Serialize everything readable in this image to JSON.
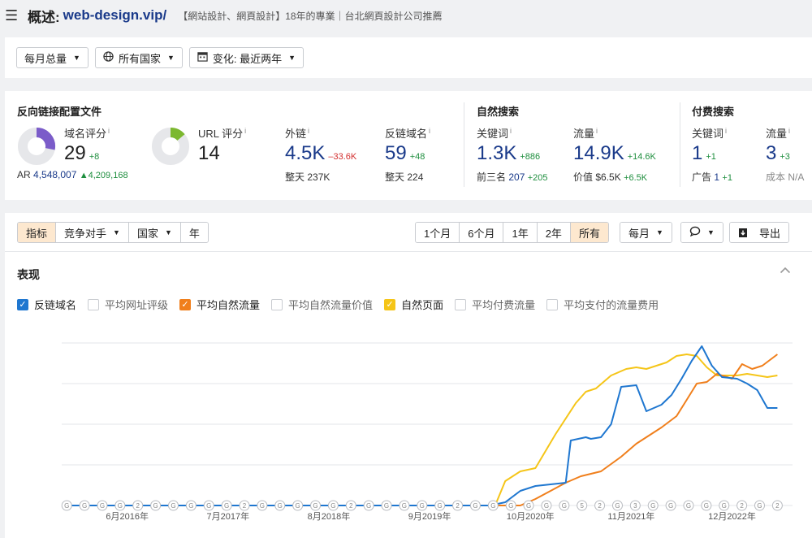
{
  "header": {
    "menu_icon": "hamburger-icon",
    "title_prefix": "概述:",
    "title_domain": "web-design.vip/",
    "description": "【網站設計、網頁設計】18年的專業｜台北網頁設計公司推薦"
  },
  "filters": {
    "volume": "每月总量",
    "country": "所有国家",
    "change": "变化: 最近两年",
    "country_icon": "globe-icon",
    "change_icon": "calendar-icon"
  },
  "backlinks": {
    "title": "反向链接配置文件",
    "dr_label": "域名评分",
    "dr_value": "29",
    "dr_delta": "+8",
    "ar_label": "AR",
    "ar_value": "4,548,007",
    "ar_delta": "▲4,209,168",
    "ur_label": "URL 评分",
    "ur_value": "14",
    "ext_label": "外链",
    "ext_value": "4.5K",
    "ext_delta": "–33.6K",
    "ext_sub_label": "整天",
    "ext_sub_value": "237K",
    "rd_label": "反链域名",
    "rd_value": "59",
    "rd_delta": "+48",
    "rd_sub_label": "整天",
    "rd_sub_value": "224",
    "info": "i"
  },
  "organic": {
    "title": "自然搜索",
    "kw_label": "关键词",
    "kw_value": "1.3K",
    "kw_delta": "+886",
    "top3_label": "前三名",
    "top3_value": "207",
    "top3_delta": "+205",
    "traffic_label": "流量",
    "traffic_value": "14.9K",
    "traffic_delta": "+14.6K",
    "value_label": "价值",
    "value_value": "$6.5K",
    "value_delta": "+6.5K"
  },
  "paid": {
    "title": "付费搜索",
    "kw_label": "关键词",
    "kw_value": "1",
    "kw_delta": "+1",
    "ads_label": "广告",
    "ads_value": "1",
    "ads_delta": "+1",
    "traffic_label": "流量",
    "traffic_value": "3",
    "traffic_delta": "+3",
    "cost_label": "成本",
    "cost_value": "N/A"
  },
  "toolbar": {
    "tabs": [
      "指标",
      "竞争对手",
      "国家",
      "年"
    ],
    "ranges": [
      "1个月",
      "6个月",
      "1年",
      "2年",
      "所有"
    ],
    "interval": "每月",
    "comment_icon": "comment-icon",
    "export": "导出",
    "export_icon": "download-icon"
  },
  "performance": {
    "title": "表现",
    "collapse_icon": "chevron-up-icon",
    "legend": [
      {
        "label": "反链域名",
        "checked": true,
        "color": "#1f77d0"
      },
      {
        "label": "平均网址评级",
        "checked": false
      },
      {
        "label": "平均自然流量",
        "checked": true,
        "color": "#f07f1c"
      },
      {
        "label": "平均自然流量价值",
        "checked": false
      },
      {
        "label": "自然页面",
        "checked": true,
        "color": "#f5c518"
      },
      {
        "label": "平均付费流量",
        "checked": false
      },
      {
        "label": "平均支付的流量费用",
        "checked": false
      }
    ]
  },
  "chart_data": {
    "type": "line",
    "x_ticks": [
      "6月2016年",
      "7月2017年",
      "8月2018年",
      "9月2019年",
      "10月2020年",
      "11月2021年",
      "12月2022年"
    ],
    "grid": true,
    "annotation_markers": [
      "G",
      "G",
      "G",
      "G",
      "2",
      "G",
      "G",
      "G",
      "G",
      "G",
      "2",
      "G",
      "G",
      "G",
      "G",
      "G",
      "2",
      "G",
      "G",
      "G",
      "G",
      "G",
      "2",
      "G",
      "G",
      "G",
      "G",
      "G",
      "G",
      "5",
      "2",
      "G",
      "3",
      "G",
      "G",
      "G",
      "G",
      "G",
      "2",
      "G",
      "2"
    ],
    "series": [
      {
        "name": "反链域名",
        "color": "#1f77d0",
        "values": [
          [
            2015.75,
            0
          ],
          [
            2020.0,
            0
          ],
          [
            2020.15,
            2
          ],
          [
            2020.3,
            9
          ],
          [
            2020.45,
            12
          ],
          [
            2020.6,
            13
          ],
          [
            2020.75,
            14
          ],
          [
            2020.8,
            40
          ],
          [
            2020.95,
            42
          ],
          [
            2021.0,
            41
          ],
          [
            2021.1,
            42
          ],
          [
            2021.2,
            50
          ],
          [
            2021.3,
            73
          ],
          [
            2021.45,
            74
          ],
          [
            2021.55,
            58
          ],
          [
            2021.7,
            62
          ],
          [
            2021.8,
            68
          ],
          [
            2021.9,
            78
          ],
          [
            2022.0,
            89
          ],
          [
            2022.1,
            98
          ],
          [
            2022.2,
            86
          ],
          [
            2022.3,
            79
          ],
          [
            2022.45,
            78
          ],
          [
            2022.55,
            75
          ],
          [
            2022.65,
            71
          ],
          [
            2022.75,
            60
          ],
          [
            2022.85,
            60
          ]
        ]
      },
      {
        "name": "平均自然流量",
        "color": "#f07f1c",
        "values": [
          [
            2015.75,
            0
          ],
          [
            2020.3,
            0
          ],
          [
            2020.45,
            4
          ],
          [
            2020.6,
            9
          ],
          [
            2020.75,
            14
          ],
          [
            2020.9,
            18
          ],
          [
            2021.1,
            21
          ],
          [
            2021.3,
            30
          ],
          [
            2021.45,
            38
          ],
          [
            2021.55,
            42
          ],
          [
            2021.7,
            48
          ],
          [
            2021.85,
            55
          ],
          [
            2021.95,
            65
          ],
          [
            2022.05,
            75
          ],
          [
            2022.15,
            76
          ],
          [
            2022.25,
            81
          ],
          [
            2022.4,
            78
          ],
          [
            2022.5,
            87
          ],
          [
            2022.6,
            84
          ],
          [
            2022.7,
            86
          ],
          [
            2022.85,
            93
          ]
        ]
      },
      {
        "name": "自然页面",
        "color": "#f5c518",
        "values": [
          [
            2015.75,
            0
          ],
          [
            2020.05,
            0
          ],
          [
            2020.15,
            15
          ],
          [
            2020.3,
            21
          ],
          [
            2020.45,
            23
          ],
          [
            2020.65,
            44
          ],
          [
            2020.85,
            63
          ],
          [
            2020.95,
            70
          ],
          [
            2021.05,
            72
          ],
          [
            2021.2,
            80
          ],
          [
            2021.35,
            84
          ],
          [
            2021.45,
            85
          ],
          [
            2021.55,
            84
          ],
          [
            2021.65,
            86
          ],
          [
            2021.75,
            88
          ],
          [
            2021.85,
            92
          ],
          [
            2021.95,
            93
          ],
          [
            2022.05,
            92
          ],
          [
            2022.15,
            85
          ],
          [
            2022.25,
            80
          ],
          [
            2022.35,
            80
          ],
          [
            2022.45,
            80
          ],
          [
            2022.55,
            81
          ],
          [
            2022.65,
            80
          ],
          [
            2022.75,
            79
          ],
          [
            2022.85,
            80
          ]
        ]
      }
    ]
  }
}
